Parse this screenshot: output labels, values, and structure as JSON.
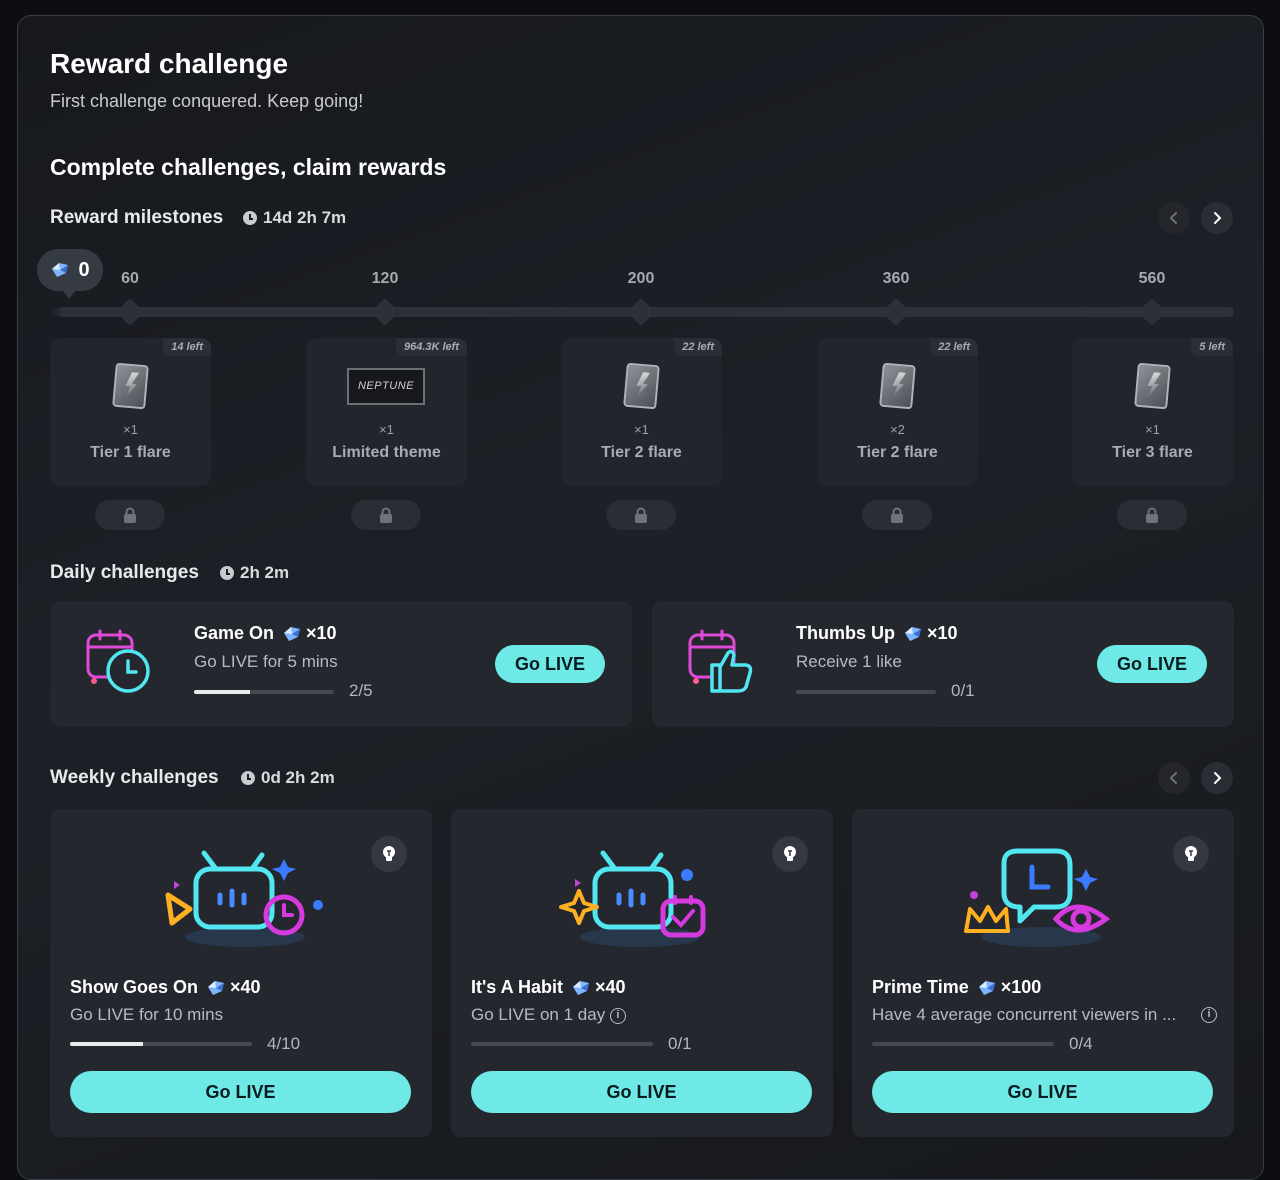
{
  "header": {
    "title": "Reward challenge",
    "subtitle": "First challenge conquered. Keep going!",
    "section_title": "Complete challenges, claim rewards"
  },
  "milestones": {
    "label": "Reward milestones",
    "timer": "14d 2h 7m",
    "current_points": "0",
    "items": [
      {
        "points": "60",
        "left": "14 left",
        "qty": "×1",
        "name": "Tier 1 flare",
        "image": "flare"
      },
      {
        "points": "120",
        "left": "964.3K left",
        "qty": "×1",
        "name": "Limited theme",
        "image": "theme",
        "theme_label": "NEPTUNE"
      },
      {
        "points": "200",
        "left": "22 left",
        "qty": "×1",
        "name": "Tier 2 flare",
        "image": "flare"
      },
      {
        "points": "360",
        "left": "22 left",
        "qty": "×2",
        "name": "Tier 2 flare",
        "image": "flare"
      },
      {
        "points": "560",
        "left": "5 left",
        "qty": "×1",
        "name": "Tier 3 flare",
        "image": "flare"
      }
    ]
  },
  "daily": {
    "label": "Daily challenges",
    "timer": "2h 2m",
    "items": [
      {
        "name": "Game On",
        "points": "×10",
        "desc": "Go LIVE for 5 mins",
        "progress_text": "2/5",
        "progress": 0.4,
        "button": "Go LIVE"
      },
      {
        "name": "Thumbs Up",
        "points": "×10",
        "desc": "Receive 1 like",
        "progress_text": "0/1",
        "progress": 0,
        "button": "Go LIVE"
      }
    ]
  },
  "weekly": {
    "label": "Weekly challenges",
    "timer": "0d 2h 2m",
    "items": [
      {
        "name": "Show Goes On",
        "points": "×40",
        "desc": "Go LIVE for 10 mins",
        "progress_text": "4/10",
        "progress": 0.4,
        "button": "Go LIVE"
      },
      {
        "name": "It's A Habit",
        "points": "×40",
        "desc": "Go LIVE on 1 day",
        "progress_text": "0/1",
        "progress": 0,
        "button": "Go LIVE"
      },
      {
        "name": "Prime Time",
        "points": "×100",
        "desc": "Have 4 average concurrent viewers in ...",
        "progress_text": "0/4",
        "progress": 0,
        "button": "Go LIVE"
      }
    ]
  },
  "colors": {
    "accent": "#6ee9e6",
    "card": "#24272e",
    "track": "#2c3038"
  },
  "icons": [
    "clock-icon",
    "gem-icon",
    "chevron-left-icon",
    "chevron-right-icon",
    "lock-icon",
    "lightbulb-icon",
    "info-icon",
    "calendar-clock-icon",
    "calendar-thumbsup-icon",
    "tv-play-icon",
    "tv-calendar-icon",
    "chat-eye-icon"
  ]
}
